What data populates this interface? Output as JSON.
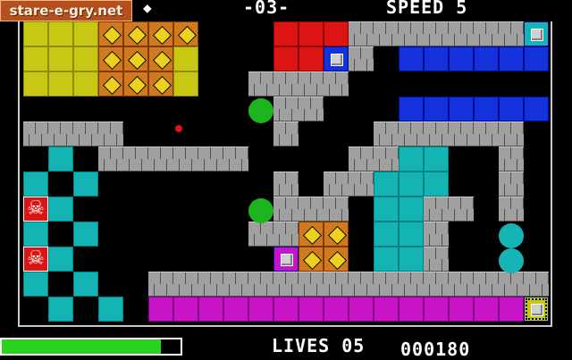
{
  "hud": {
    "logo": "stare-e-gry.net",
    "level": "-03-",
    "speed": "SPEED 5",
    "lives_label": "LIVES 05",
    "score": "000180",
    "energy_fraction": 0.89
  },
  "colors": {
    "brick": "#a0a0a0",
    "yellow": "#c8c814",
    "orange": "#d2781e",
    "red": "#dc1414",
    "blue": "#1432dc",
    "cyan": "#14b4b4",
    "magenta": "#c814c8",
    "green": "#1eb41e",
    "energy": "#28d21e"
  },
  "icons": {
    "speed_indicator": "diamond-icon",
    "skull": "skull-icon",
    "switch": "switch-block-icon",
    "ball": "ball-icon"
  }
}
